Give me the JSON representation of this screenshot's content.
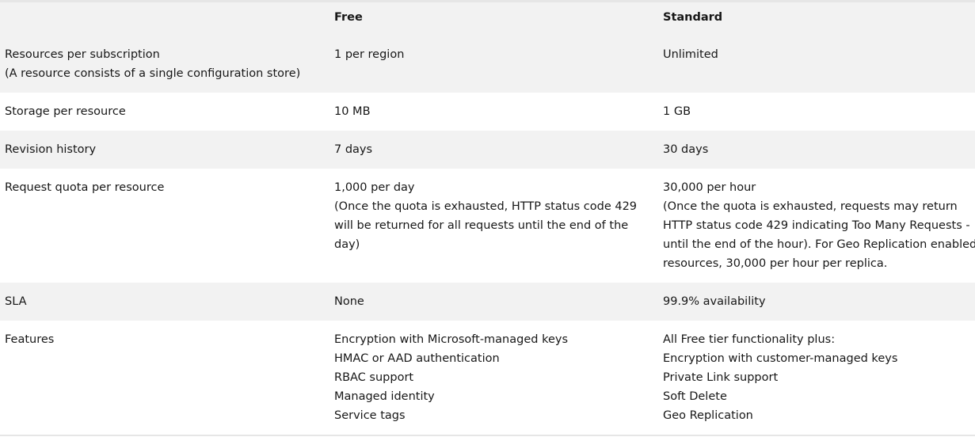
{
  "headers": [
    "",
    "Free",
    "Standard"
  ],
  "rows": [
    {
      "label": [
        "Resources per subscription",
        "(A resource consists of a single configuration store)"
      ],
      "free": [
        "1 per region"
      ],
      "standard": [
        "Unlimited"
      ]
    },
    {
      "label": [
        "Storage per resource"
      ],
      "free": [
        "10 MB"
      ],
      "standard": [
        "1 GB"
      ]
    },
    {
      "label": [
        "Revision history"
      ],
      "free": [
        "7 days"
      ],
      "standard": [
        "30 days"
      ]
    },
    {
      "label": [
        "Request quota per resource"
      ],
      "free": [
        "1,000 per day",
        "(Once the quota is exhausted, HTTP status code 429",
        "will be returned for all requests until the end of the",
        "day)"
      ],
      "standard": [
        "30,000 per hour",
        "(Once the quota is exhausted, requests may return",
        "HTTP status code 429 indicating Too Many Requests -",
        "until the end of the hour). For Geo Replication enabled",
        "resources, 30,000 per hour per replica."
      ]
    },
    {
      "label": [
        "SLA"
      ],
      "free": [
        "None"
      ],
      "standard": [
        "99.9% availability"
      ]
    },
    {
      "label": [
        "Features"
      ],
      "free": [
        "Encryption with Microsoft-managed keys",
        "HMAC or AAD authentication",
        "RBAC support",
        "Managed identity",
        "Service tags"
      ],
      "standard": [
        "All Free tier functionality plus:",
        "Encryption with customer-managed keys",
        "Private Link support",
        "Soft Delete",
        "Geo Replication"
      ]
    }
  ]
}
